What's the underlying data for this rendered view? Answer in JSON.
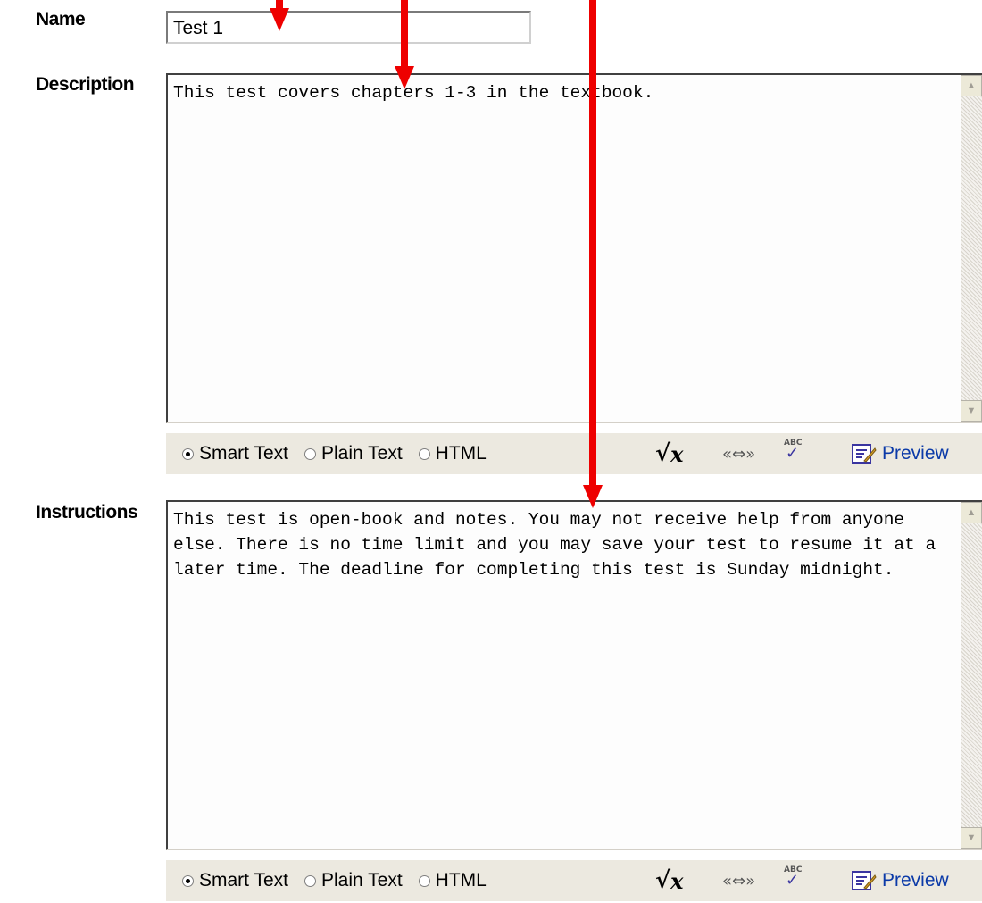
{
  "form": {
    "name_label": "Name",
    "name_value": "Test 1",
    "description_label": "Description",
    "description_text": "This test covers chapters 1-3 in the textbook.",
    "instructions_label": "Instructions",
    "instructions_text": "This test is open-book and notes. You may not receive help from anyone else. There is no time limit and you may save your test to resume it at a later time. The deadline for completing this test is Sunday midnight."
  },
  "editor_toolbar": {
    "options": [
      "Smart Text",
      "Plain Text",
      "HTML"
    ],
    "selected": "Smart Text",
    "preview_label": "Preview",
    "icons": [
      "square-root-icon",
      "link-icon",
      "spell-check-icon",
      "preview-icon"
    ]
  },
  "colors": {
    "arrow": "#ee0000",
    "preview_link": "#0b3aa8",
    "toolbar_bg": "#ece9e0"
  }
}
